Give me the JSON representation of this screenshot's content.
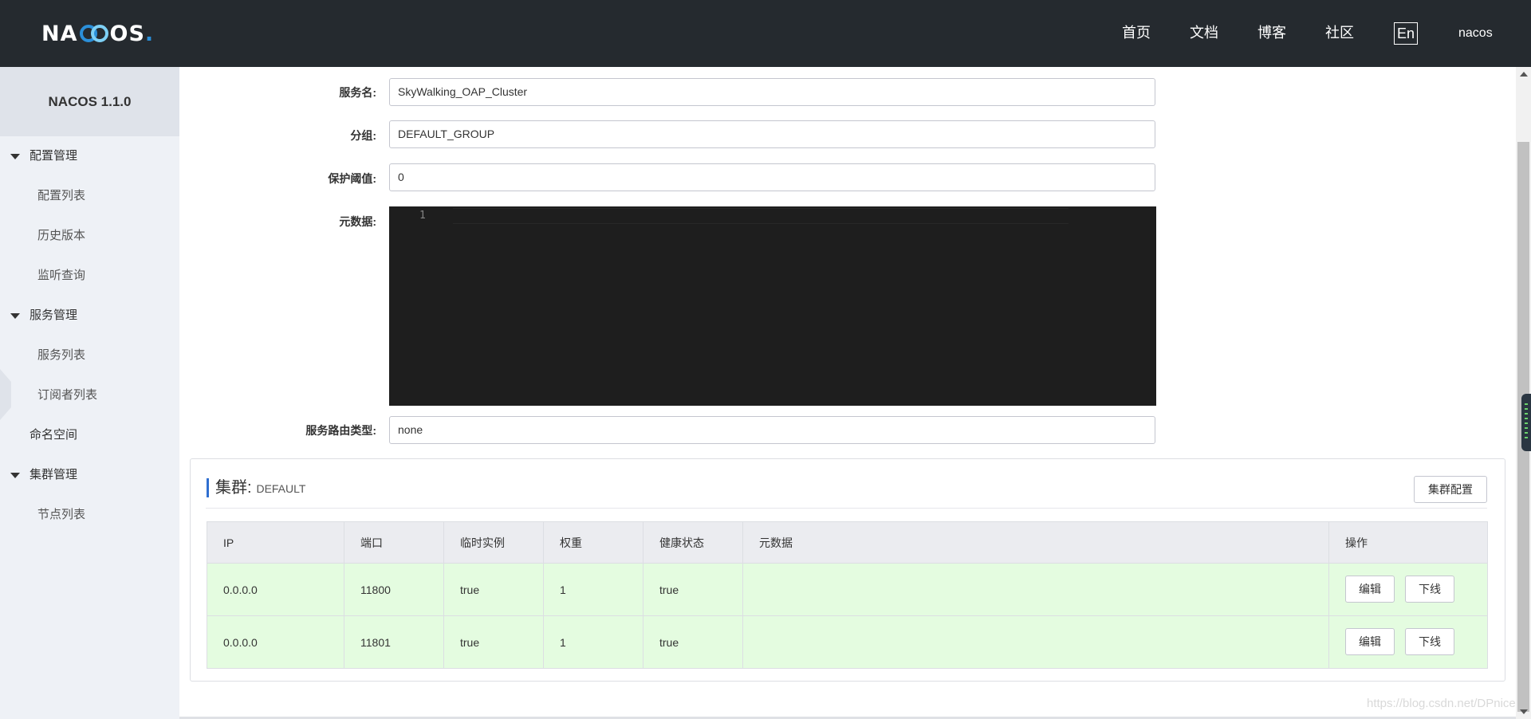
{
  "header": {
    "logo_text": "NACOS",
    "nav": [
      "首页",
      "文档",
      "博客",
      "社区"
    ],
    "lang": "En",
    "user": "nacos"
  },
  "sidebar": {
    "title": "NACOS 1.1.0",
    "groups": [
      {
        "label": "配置管理",
        "items": [
          "配置列表",
          "历史版本",
          "监听查询"
        ]
      },
      {
        "label": "服务管理",
        "items": [
          "服务列表",
          "订阅者列表"
        ]
      },
      {
        "label": "命名空间"
      },
      {
        "label": "集群管理",
        "items": [
          "节点列表"
        ]
      }
    ]
  },
  "form": {
    "service_name_label": "服务名:",
    "service_name": "SkyWalking_OAP_Cluster",
    "group_label": "分组:",
    "group": "DEFAULT_GROUP",
    "threshold_label": "保护阈值:",
    "threshold": "0",
    "metadata_label": "元数据:",
    "editor_line": "1",
    "route_type_label": "服务路由类型:",
    "route_type": "none"
  },
  "cluster": {
    "title": "集群:",
    "name": "DEFAULT",
    "config_button": "集群配置",
    "columns": [
      "IP",
      "端口",
      "临时实例",
      "权重",
      "健康状态",
      "元数据",
      "操作"
    ],
    "rows": [
      {
        "ip": "0.0.0.0",
        "port": "11800",
        "ephemeral": "true",
        "weight": "1",
        "healthy": "true",
        "metadata": "",
        "edit": "编辑",
        "offline": "下线"
      },
      {
        "ip": "0.0.0.0",
        "port": "11801",
        "ephemeral": "true",
        "weight": "1",
        "healthy": "true",
        "metadata": "",
        "edit": "编辑",
        "offline": "下线"
      }
    ]
  },
  "watermark": "https://blog.csdn.net/DPnice"
}
